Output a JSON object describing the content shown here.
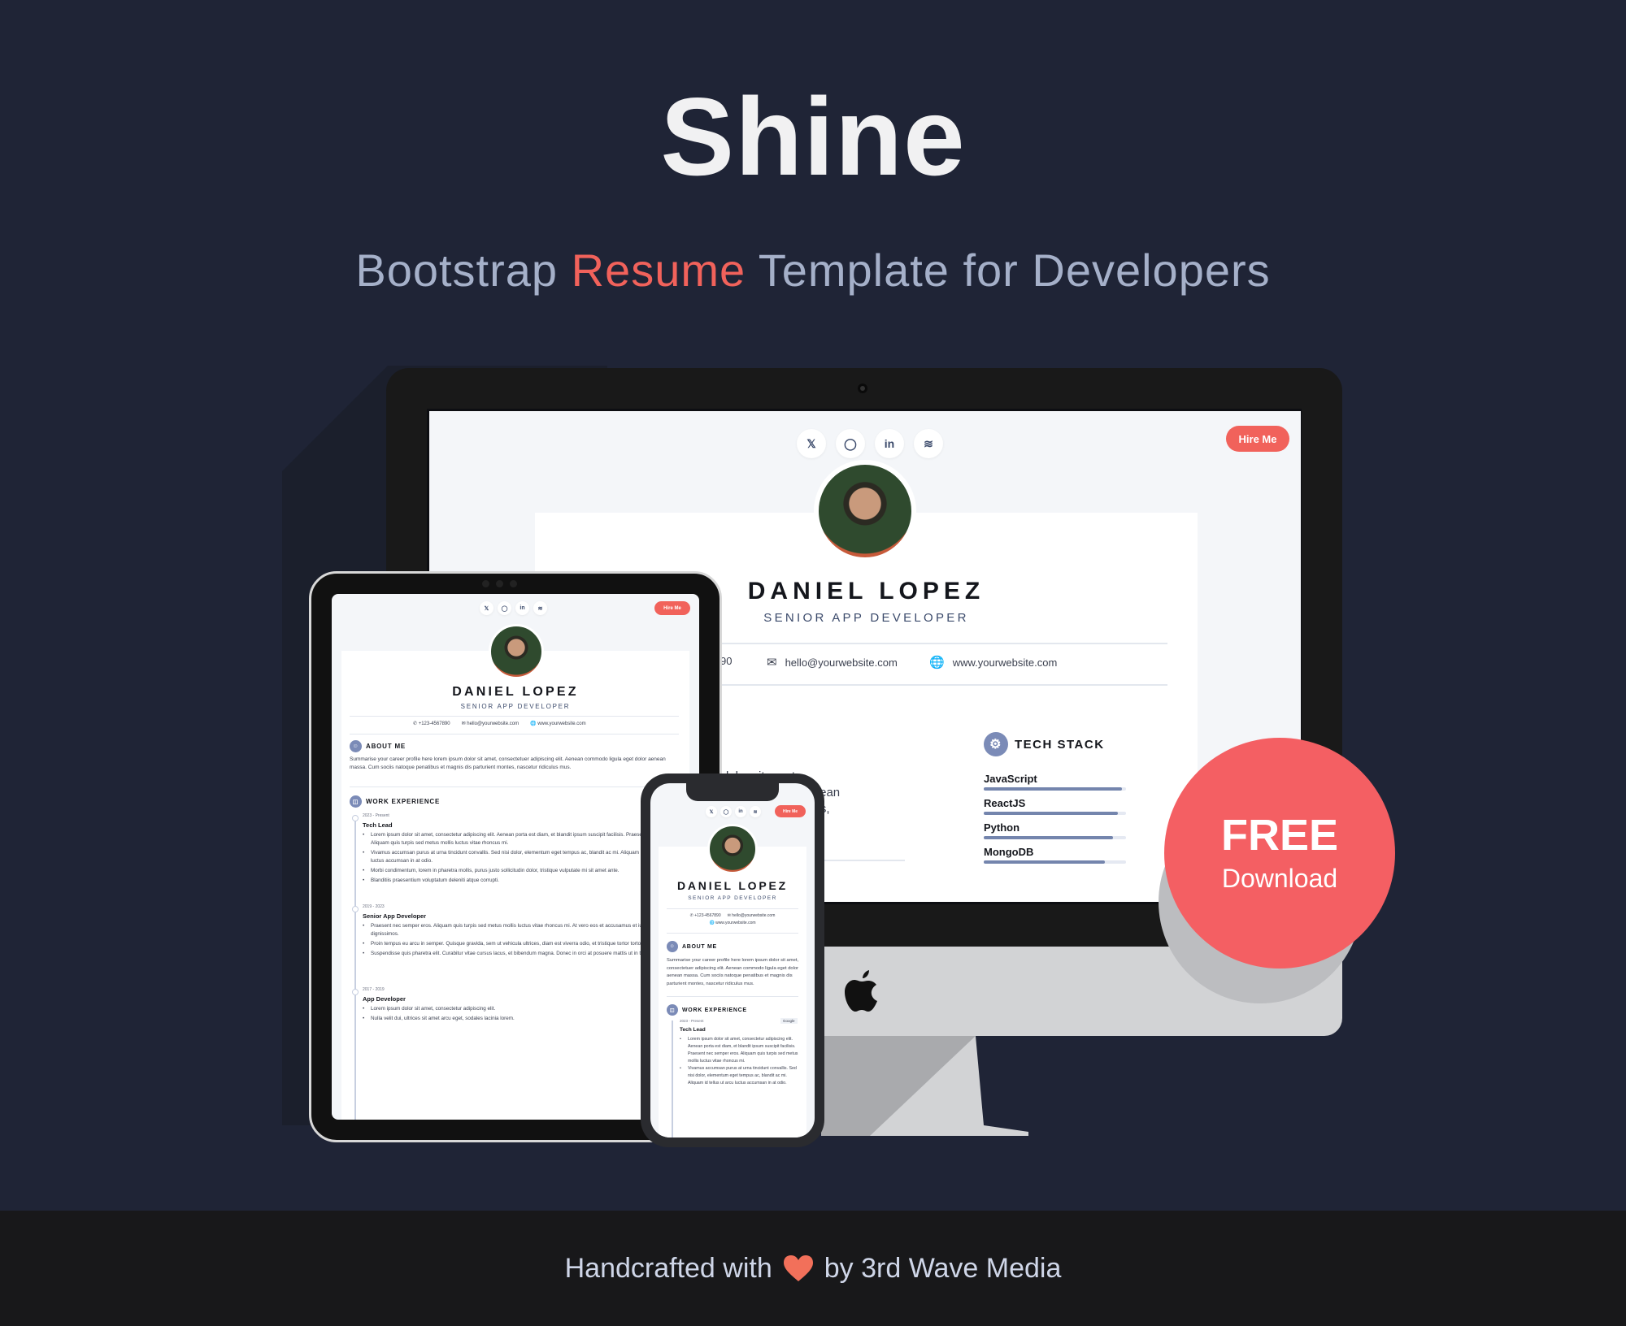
{
  "hero": {
    "title": "Shine",
    "subtitle_pre": "Bootstrap",
    "subtitle_accent": "Resume",
    "subtitle_post": "Template for Developers"
  },
  "colors": {
    "background": "#1f2436",
    "accent": "#f1625b",
    "badge": "#f45f63",
    "skill_bar": "#7485ad",
    "footer_bg": "#18181a"
  },
  "resume": {
    "social_icons": [
      "twitter-icon",
      "github-icon",
      "linkedin-icon",
      "stackoverflow-icon"
    ],
    "hire_button": "Hire Me",
    "name": "DANIEL LOPEZ",
    "role": "SENIOR APP DEVELOPER",
    "phone": "+123-4567890",
    "phone_partial": "90",
    "email": "hello@yourwebsite.com",
    "website": "www.yourwebsite.com",
    "about_title": "ABOUT ME",
    "about_text": "Summarise your career profile here lorem ipsum dolor sit amet, consectetuer adipiscing elit. Aenean commodo ligula eget dolor aenean massa. Cum sociis natoque penatibus et magnis dis parturient montes, nascetur ridiculus mus.",
    "about_partial_lines": [
      "dolor sit amet,",
      "ula eget dolor aenean",
      "s parturient montes,"
    ],
    "work_title": "WORK EXPERIENCE",
    "tech_title": "TECH STACK",
    "skills": [
      {
        "label": "JavaScript",
        "level": 0.97
      },
      {
        "label": "ReactJS",
        "level": 0.94
      },
      {
        "label": "Python",
        "level": 0.91
      },
      {
        "label": "MongoDB",
        "level": 0.85
      }
    ],
    "jobs": [
      {
        "date": "2023 - Present",
        "title": "Tech Lead",
        "company": "Google",
        "bullets": [
          "Lorem ipsum dolor sit amet, consectetur adipiscing elit. Aenean porta est diam, et blandit ipsum suscipit facilisis. Praesent nec semper eros. Aliquam quis turpis sed metus mollis luctus vitae rhoncus mi.",
          "Vivamus accumsan purus at urna tincidunt convallis. Sed nisi dolor, elementum eget tempus ac, blandit ac mi. Aliquam id tellus ut arcu luctus accumsan in at odio.",
          "Morbi condimentum, lorem in pharetra mollis, purus justo sollicitudin dolor, tristique vulputate mi sit amet ante.",
          "Blanditiis praesentium voluptatum deleniti atque corrupti."
        ]
      },
      {
        "date": "2019 - 2023",
        "title": "Senior App Developer",
        "bullets": [
          "Praesent nec semper eros. Aliquam quis turpis sed metus mollis luctus vitae rhoncus mi. At vero eos et accusamus et iusto odio dignissimos.",
          "Proin tempus eu arcu in semper. Quisque gravida, sem ut vehicula ultrices, diam est viverra odio, et tristique tortor tortor sed neque.",
          "Suspendisse quis pharetra elit. Curabitur vitae cursus lacus, et bibendum magna. Donec in orci at posuere mattis ut in turpis."
        ]
      },
      {
        "date": "2017 - 2019",
        "title": "App Developer",
        "bullets": [
          "Lorem ipsum dolor sit amet, consectetur adipiscing elit.",
          "Nulla velit dui, ultrices sit amet arcu eget, sodales lacinia lorem."
        ]
      }
    ]
  },
  "badge": {
    "line1": "FREE",
    "line2": "Download"
  },
  "footer": {
    "pre": "Handcrafted with",
    "post": "by 3rd Wave Media"
  }
}
